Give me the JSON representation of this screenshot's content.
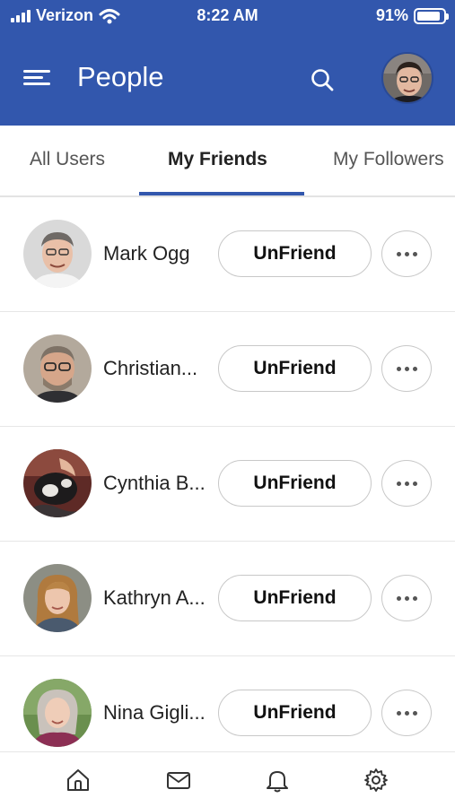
{
  "status_bar": {
    "carrier": "Verizon",
    "time": "8:22 AM",
    "battery_percent": "91%",
    "battery_level": 0.91
  },
  "header": {
    "title": "People",
    "background_color": "#3257ad",
    "icons": {
      "menu": "hamburger-menu-icon",
      "search": "search-icon",
      "profile": "user-avatar"
    }
  },
  "tabs": [
    {
      "label": "All Users",
      "active": false
    },
    {
      "label": "My Friends",
      "active": true
    },
    {
      "label": "My Followers",
      "active": false
    }
  ],
  "friends": [
    {
      "name": "Mark Ogg",
      "action_label": "UnFriend",
      "more_icon": "more-horizontal-icon"
    },
    {
      "name": "Christian...",
      "action_label": "UnFriend",
      "more_icon": "more-horizontal-icon"
    },
    {
      "name": "Cynthia B...",
      "action_label": "UnFriend",
      "more_icon": "more-horizontal-icon"
    },
    {
      "name": "Kathryn A...",
      "action_label": "UnFriend",
      "more_icon": "more-horizontal-icon"
    },
    {
      "name": "Nina Gigli...",
      "action_label": "UnFriend",
      "more_icon": "more-horizontal-icon"
    }
  ],
  "bottom_nav": {
    "items": [
      "home-icon",
      "mail-icon",
      "bell-icon",
      "gear-icon"
    ]
  }
}
